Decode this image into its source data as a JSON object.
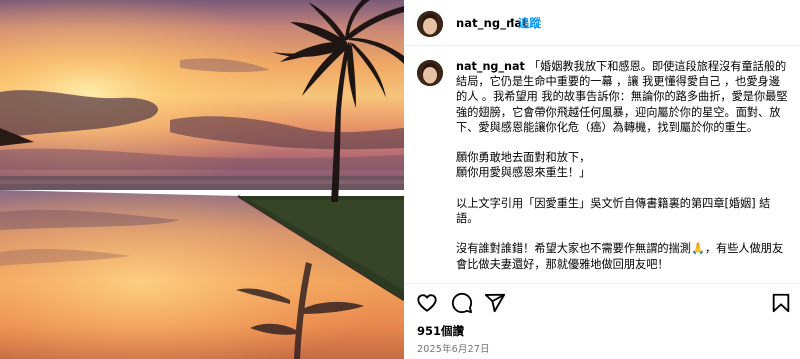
{
  "post": {
    "username": "nat_ng_nat",
    "separator": "•",
    "follow_label": "追蹤",
    "caption": {
      "username": "nat_ng_nat",
      "text": "「婚姻教我放下和感恩。即使這段旅程沒有童話般的結局，它仍是生命中重要的一幕 ，讓 我更懂得愛自己 ，也愛身邊的人 。我希望用 我的故事告訴你：無論你的路多曲折，愛是你最堅強的翅膀，它會帶你飛越任何風暴，迎向屬於你的星空。面對、放下、愛與感恩能讓你化危（癌）為轉機，找到屬於你的重生。\n\n願你勇敢地去面對和放下，\n願你用愛與感恩來重生！」\n\n以上文字引用「因愛重生」吳文忻自傳書籍裏的第四章[婚姻] 結語。\n\n沒有誰對誰錯！希望大家也不需要作無謂的揣測🙏，有些人做朋友會比做夫妻還好，那就優雅地做回朋友吧！"
    },
    "likes": "951個讚",
    "date": "2025年6月27日"
  },
  "icons": {
    "like": "heart-icon",
    "comment": "comment-bubble-icon",
    "share": "paper-plane-icon",
    "save": "bookmark-icon"
  },
  "colors": {
    "follow": "#0095f6",
    "muted": "#737373",
    "divider": "#efefef"
  }
}
